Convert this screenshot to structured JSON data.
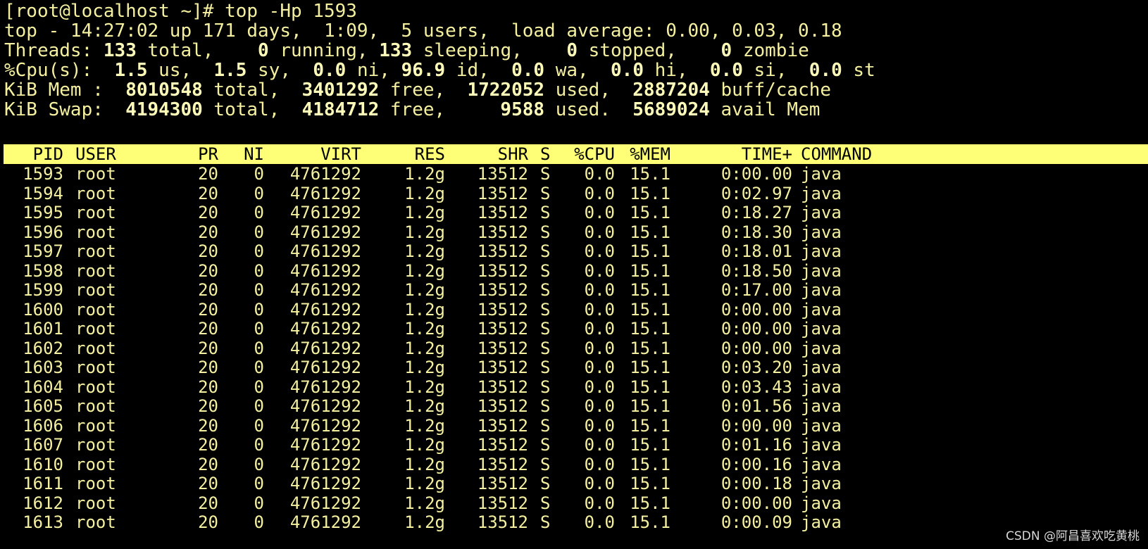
{
  "prompt": "[root@localhost ~]# top -Hp 1593",
  "summary": {
    "top": "top - 14:27:02 up 171 days,  1:09,  5 users,  load average: 0.00, 0.03, 0.18",
    "threads": {
      "label": "Threads: ",
      "total": "133",
      "total_lbl": " total,    ",
      "running": "0",
      "running_lbl": " running, ",
      "sleeping": "133",
      "sleeping_lbl": " sleeping,    ",
      "stopped": "0",
      "stopped_lbl": " stopped,    ",
      "zombie": "0",
      "zombie_lbl": " zombie"
    },
    "cpu": {
      "label": "%Cpu(s):  ",
      "us": "1.5",
      "us_lbl": " us,  ",
      "sy": "1.5",
      "sy_lbl": " sy,  ",
      "ni": "0.0",
      "ni_lbl": " ni, ",
      "id": "96.9",
      "id_lbl": " id,  ",
      "wa": "0.0",
      "wa_lbl": " wa,  ",
      "hi": "0.0",
      "hi_lbl": " hi,  ",
      "si": "0.0",
      "si_lbl": " si,  ",
      "st": "0.0",
      "st_lbl": " st"
    },
    "mem": {
      "label": "KiB Mem :  ",
      "total": "8010548",
      "total_lbl": " total,  ",
      "free": "3401292",
      "free_lbl": " free,  ",
      "used": "1722052",
      "used_lbl": " used,  ",
      "cache": "2887204",
      "cache_lbl": " buff/cache"
    },
    "swap": {
      "label": "KiB Swap:  ",
      "total": "4194300",
      "total_lbl": " total,  ",
      "free": "4184712",
      "free_lbl": " free,     ",
      "used": "9588",
      "used_lbl": " used.  ",
      "avail": "5689024",
      "avail_lbl": " avail Mem"
    }
  },
  "columns": [
    "PID",
    "USER",
    "PR",
    "NI",
    "VIRT",
    "RES",
    "SHR",
    "S",
    "%CPU",
    "%MEM",
    "TIME+",
    "COMMAND"
  ],
  "rows": [
    [
      "1593",
      "root",
      "20",
      "0",
      "4761292",
      "1.2g",
      "13512",
      "S",
      "0.0",
      "15.1",
      "0:00.00",
      "java"
    ],
    [
      "1594",
      "root",
      "20",
      "0",
      "4761292",
      "1.2g",
      "13512",
      "S",
      "0.0",
      "15.1",
      "0:02.97",
      "java"
    ],
    [
      "1595",
      "root",
      "20",
      "0",
      "4761292",
      "1.2g",
      "13512",
      "S",
      "0.0",
      "15.1",
      "0:18.27",
      "java"
    ],
    [
      "1596",
      "root",
      "20",
      "0",
      "4761292",
      "1.2g",
      "13512",
      "S",
      "0.0",
      "15.1",
      "0:18.30",
      "java"
    ],
    [
      "1597",
      "root",
      "20",
      "0",
      "4761292",
      "1.2g",
      "13512",
      "S",
      "0.0",
      "15.1",
      "0:18.01",
      "java"
    ],
    [
      "1598",
      "root",
      "20",
      "0",
      "4761292",
      "1.2g",
      "13512",
      "S",
      "0.0",
      "15.1",
      "0:18.50",
      "java"
    ],
    [
      "1599",
      "root",
      "20",
      "0",
      "4761292",
      "1.2g",
      "13512",
      "S",
      "0.0",
      "15.1",
      "0:17.00",
      "java"
    ],
    [
      "1600",
      "root",
      "20",
      "0",
      "4761292",
      "1.2g",
      "13512",
      "S",
      "0.0",
      "15.1",
      "0:00.00",
      "java"
    ],
    [
      "1601",
      "root",
      "20",
      "0",
      "4761292",
      "1.2g",
      "13512",
      "S",
      "0.0",
      "15.1",
      "0:00.00",
      "java"
    ],
    [
      "1602",
      "root",
      "20",
      "0",
      "4761292",
      "1.2g",
      "13512",
      "S",
      "0.0",
      "15.1",
      "0:00.00",
      "java"
    ],
    [
      "1603",
      "root",
      "20",
      "0",
      "4761292",
      "1.2g",
      "13512",
      "S",
      "0.0",
      "15.1",
      "0:03.20",
      "java"
    ],
    [
      "1604",
      "root",
      "20",
      "0",
      "4761292",
      "1.2g",
      "13512",
      "S",
      "0.0",
      "15.1",
      "0:03.43",
      "java"
    ],
    [
      "1605",
      "root",
      "20",
      "0",
      "4761292",
      "1.2g",
      "13512",
      "S",
      "0.0",
      "15.1",
      "0:01.56",
      "java"
    ],
    [
      "1606",
      "root",
      "20",
      "0",
      "4761292",
      "1.2g",
      "13512",
      "S",
      "0.0",
      "15.1",
      "0:00.00",
      "java"
    ],
    [
      "1607",
      "root",
      "20",
      "0",
      "4761292",
      "1.2g",
      "13512",
      "S",
      "0.0",
      "15.1",
      "0:01.16",
      "java"
    ],
    [
      "1610",
      "root",
      "20",
      "0",
      "4761292",
      "1.2g",
      "13512",
      "S",
      "0.0",
      "15.1",
      "0:00.16",
      "java"
    ],
    [
      "1611",
      "root",
      "20",
      "0",
      "4761292",
      "1.2g",
      "13512",
      "S",
      "0.0",
      "15.1",
      "0:00.18",
      "java"
    ],
    [
      "1612",
      "root",
      "20",
      "0",
      "4761292",
      "1.2g",
      "13512",
      "S",
      "0.0",
      "15.1",
      "0:00.00",
      "java"
    ],
    [
      "1613",
      "root",
      "20",
      "0",
      "4761292",
      "1.2g",
      "13512",
      "S",
      "0.0",
      "15.1",
      "0:00.09",
      "java"
    ]
  ],
  "watermark": "CSDN @阿昌喜欢吃黄桃",
  "colors": {
    "background": "#000000",
    "text": "#f4f0a0",
    "header_bar": "#ffff77",
    "header_text": "#000000"
  }
}
